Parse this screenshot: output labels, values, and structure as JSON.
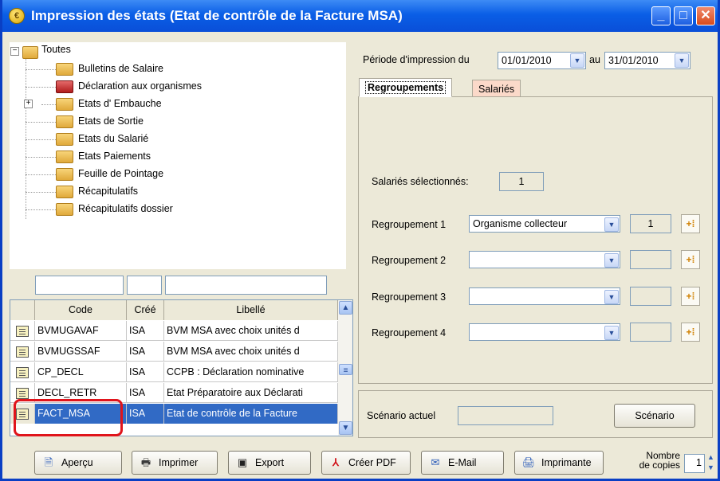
{
  "window": {
    "title": "Impression des états (Etat de contrôle de la Facture MSA)",
    "icon": "€"
  },
  "tree": {
    "root": "Toutes",
    "items": [
      {
        "label": "Bulletins de Salaire",
        "icon": "folder"
      },
      {
        "label": "Déclaration aux organismes",
        "icon": "folder-red"
      },
      {
        "label": "Etats d' Embauche",
        "icon": "folder",
        "expandable": true
      },
      {
        "label": "Etats de Sortie",
        "icon": "folder"
      },
      {
        "label": "Etats du Salarié",
        "icon": "folder"
      },
      {
        "label": "Etats Paiements",
        "icon": "folder"
      },
      {
        "label": "Feuille de Pointage",
        "icon": "folder"
      },
      {
        "label": "Récapitulatifs",
        "icon": "folder"
      },
      {
        "label": "Récapitulatifs dossier",
        "icon": "folder"
      }
    ]
  },
  "filters": {
    "code": "",
    "cree": "",
    "libelle": ""
  },
  "grid": {
    "columns": [
      "Code",
      "Créé",
      "Libellé"
    ],
    "rows": [
      {
        "code": "BVMUGAVAF",
        "cree": "ISA",
        "libelle": "BVM MSA avec choix unités d"
      },
      {
        "code": "BVMUGSSAF",
        "cree": "ISA",
        "libelle": "BVM MSA avec choix unités d"
      },
      {
        "code": "CP_DECL",
        "cree": "ISA",
        "libelle": "CCPB : Déclaration nominative"
      },
      {
        "code": "DECL_RETR",
        "cree": "ISA",
        "libelle": "Etat Préparatoire aux Déclarati"
      },
      {
        "code": "FACT_MSA",
        "cree": "ISA",
        "libelle": "Etat de contrôle de la Facture",
        "selected": true
      }
    ]
  },
  "periode": {
    "label": "Période d'impression du",
    "from": "01/01/2010",
    "au_label": "au",
    "to": "31/01/2010"
  },
  "tabs": [
    {
      "label": "Regroupements",
      "active": true
    },
    {
      "label": "Salariés",
      "active": false
    }
  ],
  "regroupements": {
    "selected_label": "Salariés sélectionnés:",
    "selected_count": "1",
    "rows": [
      {
        "label": "Regroupement 1",
        "value": "Organisme collecteur",
        "count": "1"
      },
      {
        "label": "Regroupement 2",
        "value": "",
        "count": ""
      },
      {
        "label": "Regroupement 3",
        "value": "",
        "count": ""
      },
      {
        "label": "Regroupement 4",
        "value": "",
        "count": ""
      }
    ]
  },
  "scenario": {
    "label": "Scénario actuel",
    "value": "",
    "button": "Scénario"
  },
  "toolbar": {
    "apercu": "Aperçu",
    "imprimer": "Imprimer",
    "export": "Export",
    "pdf": "Créer PDF",
    "email": "E-Mail",
    "imprimante": "Imprimante",
    "copies_label_1": "Nombre",
    "copies_label_2": "de copies",
    "copies": "1"
  },
  "colors": {
    "title_bar": "#0a5ee6",
    "selection": "#316ac5",
    "highlight": "#e0141b"
  }
}
